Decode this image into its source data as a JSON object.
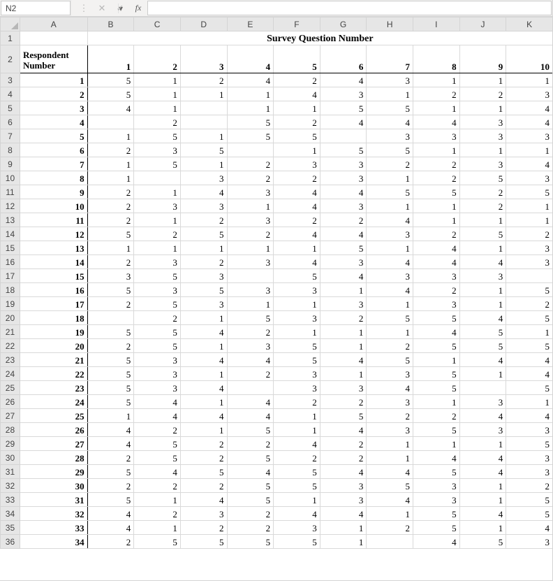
{
  "nameBox": {
    "value": "N2"
  },
  "formulaBar": {
    "value": ""
  },
  "icons": {
    "dropdown": "▾",
    "cancel": "✕",
    "confirm": "✓",
    "fx": "fx",
    "vsep": "⋮"
  },
  "columns": [
    "A",
    "B",
    "C",
    "D",
    "E",
    "F",
    "G",
    "H",
    "I",
    "J",
    "K"
  ],
  "rowHeaders": [
    "1",
    "2",
    "3",
    "4",
    "5",
    "6",
    "7",
    "8",
    "9",
    "10",
    "11",
    "12",
    "13",
    "14",
    "15",
    "16",
    "17",
    "18",
    "19",
    "20",
    "21",
    "22",
    "23",
    "24",
    "25",
    "26",
    "27",
    "28",
    "29",
    "30",
    "31",
    "32",
    "33",
    "34",
    "35",
    "36"
  ],
  "titleRow": {
    "text": "Survey Question Number"
  },
  "headerRow2": {
    "A_line1": "Respondent",
    "A_line2": "Number",
    "cols": [
      "1",
      "2",
      "3",
      "4",
      "5",
      "6",
      "7",
      "8",
      "9",
      "10"
    ]
  },
  "selectedCell": "N2",
  "data": [
    {
      "resp": "1",
      "v": [
        "5",
        "1",
        "2",
        "4",
        "2",
        "4",
        "3",
        "1",
        "1",
        "1"
      ]
    },
    {
      "resp": "2",
      "v": [
        "5",
        "1",
        "1",
        "1",
        "4",
        "3",
        "1",
        "2",
        "2",
        "3"
      ]
    },
    {
      "resp": "3",
      "v": [
        "4",
        "1",
        "",
        "1",
        "1",
        "5",
        "5",
        "1",
        "1",
        "4"
      ]
    },
    {
      "resp": "4",
      "v": [
        "",
        "2",
        "",
        "5",
        "2",
        "4",
        "4",
        "4",
        "3",
        "4"
      ]
    },
    {
      "resp": "5",
      "v": [
        "1",
        "5",
        "1",
        "5",
        "5",
        "",
        "3",
        "3",
        "3",
        "3"
      ]
    },
    {
      "resp": "6",
      "v": [
        "2",
        "3",
        "5",
        "",
        "1",
        "5",
        "5",
        "1",
        "1",
        "1"
      ]
    },
    {
      "resp": "7",
      "v": [
        "1",
        "5",
        "1",
        "2",
        "3",
        "3",
        "2",
        "2",
        "3",
        "4"
      ]
    },
    {
      "resp": "8",
      "v": [
        "1",
        "",
        "3",
        "2",
        "2",
        "3",
        "1",
        "2",
        "5",
        "3"
      ]
    },
    {
      "resp": "9",
      "v": [
        "2",
        "1",
        "4",
        "3",
        "4",
        "4",
        "5",
        "5",
        "2",
        "5"
      ]
    },
    {
      "resp": "10",
      "v": [
        "2",
        "3",
        "3",
        "1",
        "4",
        "3",
        "1",
        "1",
        "2",
        "1"
      ]
    },
    {
      "resp": "11",
      "v": [
        "2",
        "1",
        "2",
        "3",
        "2",
        "2",
        "4",
        "1",
        "1",
        "1"
      ]
    },
    {
      "resp": "12",
      "v": [
        "5",
        "2",
        "5",
        "2",
        "4",
        "4",
        "3",
        "2",
        "5",
        "2"
      ]
    },
    {
      "resp": "13",
      "v": [
        "1",
        "1",
        "1",
        "1",
        "1",
        "5",
        "1",
        "4",
        "1",
        "3"
      ]
    },
    {
      "resp": "14",
      "v": [
        "2",
        "3",
        "2",
        "3",
        "4",
        "3",
        "4",
        "4",
        "4",
        "3"
      ]
    },
    {
      "resp": "15",
      "v": [
        "3",
        "5",
        "3",
        "",
        "5",
        "4",
        "3",
        "3",
        "3",
        ""
      ]
    },
    {
      "resp": "16",
      "v": [
        "5",
        "3",
        "5",
        "3",
        "3",
        "1",
        "4",
        "2",
        "1",
        "5"
      ]
    },
    {
      "resp": "17",
      "v": [
        "2",
        "5",
        "3",
        "1",
        "1",
        "3",
        "1",
        "3",
        "1",
        "2"
      ]
    },
    {
      "resp": "18",
      "v": [
        "",
        "2",
        "1",
        "5",
        "3",
        "2",
        "5",
        "5",
        "4",
        "5"
      ]
    },
    {
      "resp": "19",
      "v": [
        "5",
        "5",
        "4",
        "2",
        "1",
        "1",
        "1",
        "4",
        "5",
        "1"
      ]
    },
    {
      "resp": "20",
      "v": [
        "2",
        "5",
        "1",
        "3",
        "5",
        "1",
        "2",
        "5",
        "5",
        "5"
      ]
    },
    {
      "resp": "21",
      "v": [
        "5",
        "3",
        "4",
        "4",
        "5",
        "4",
        "5",
        "1",
        "4",
        "4"
      ]
    },
    {
      "resp": "22",
      "v": [
        "5",
        "3",
        "1",
        "2",
        "3",
        "1",
        "3",
        "5",
        "1",
        "4"
      ]
    },
    {
      "resp": "23",
      "v": [
        "5",
        "3",
        "4",
        "",
        "3",
        "3",
        "4",
        "5",
        "",
        "5"
      ]
    },
    {
      "resp": "24",
      "v": [
        "5",
        "4",
        "1",
        "4",
        "2",
        "2",
        "3",
        "1",
        "3",
        "1"
      ]
    },
    {
      "resp": "25",
      "v": [
        "1",
        "4",
        "4",
        "4",
        "1",
        "5",
        "2",
        "2",
        "4",
        "4"
      ]
    },
    {
      "resp": "26",
      "v": [
        "4",
        "2",
        "1",
        "5",
        "1",
        "4",
        "3",
        "5",
        "3",
        "3"
      ]
    },
    {
      "resp": "27",
      "v": [
        "4",
        "5",
        "2",
        "2",
        "4",
        "2",
        "1",
        "1",
        "1",
        "5"
      ]
    },
    {
      "resp": "28",
      "v": [
        "2",
        "5",
        "2",
        "5",
        "2",
        "2",
        "1",
        "4",
        "4",
        "3"
      ]
    },
    {
      "resp": "29",
      "v": [
        "5",
        "4",
        "5",
        "4",
        "5",
        "4",
        "4",
        "5",
        "4",
        "3"
      ]
    },
    {
      "resp": "30",
      "v": [
        "2",
        "2",
        "2",
        "5",
        "5",
        "3",
        "5",
        "3",
        "1",
        "2"
      ]
    },
    {
      "resp": "31",
      "v": [
        "5",
        "1",
        "4",
        "5",
        "1",
        "3",
        "4",
        "3",
        "1",
        "5"
      ]
    },
    {
      "resp": "32",
      "v": [
        "4",
        "2",
        "3",
        "2",
        "4",
        "4",
        "1",
        "5",
        "4",
        "5"
      ]
    },
    {
      "resp": "33",
      "v": [
        "4",
        "1",
        "2",
        "2",
        "3",
        "1",
        "2",
        "5",
        "1",
        "4"
      ]
    },
    {
      "resp": "34",
      "v": [
        "2",
        "5",
        "5",
        "5",
        "5",
        "1",
        "",
        "4",
        "5",
        "3"
      ]
    }
  ]
}
